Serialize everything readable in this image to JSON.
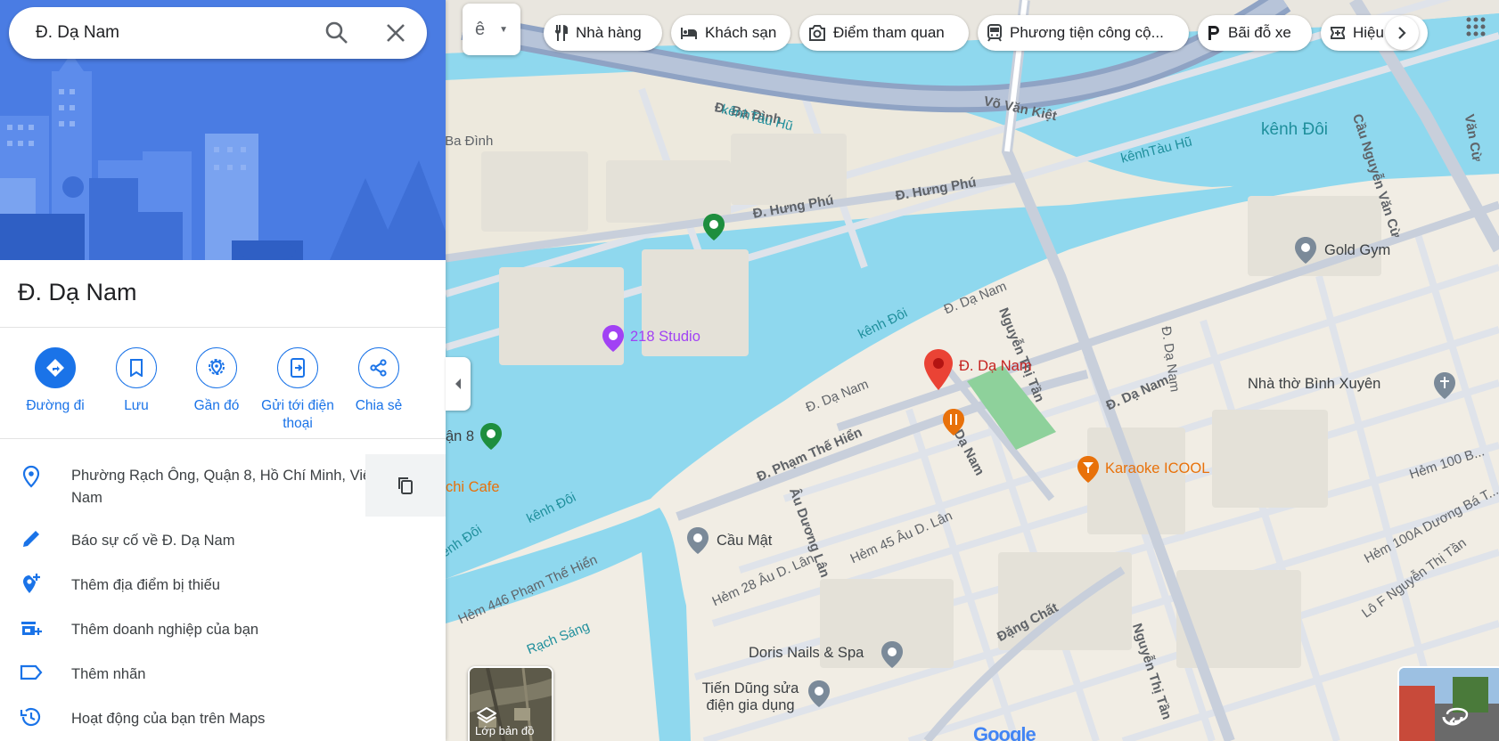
{
  "search": {
    "value": "Đ. Dạ Nam",
    "icon_search": "search-icon",
    "icon_close": "close-icon"
  },
  "place": {
    "title": "Đ. Dạ Nam"
  },
  "actions": [
    {
      "label": "Đường đi",
      "icon": "directions-icon"
    },
    {
      "label": "Lưu",
      "icon": "bookmark-icon"
    },
    {
      "label": "Gần đó",
      "icon": "nearby-icon"
    },
    {
      "label": "Gửi tới điện thoại",
      "icon": "send-to-phone-icon"
    },
    {
      "label": "Chia sẻ",
      "icon": "share-icon"
    }
  ],
  "info": {
    "address": "Phường Rạch Ông, Quận 8, Hồ Chí Minh, Việt Nam",
    "report": "Báo sự cố về Đ. Dạ Nam",
    "add_place": "Thêm địa điểm bị thiếu",
    "add_business": "Thêm doanh nghiệp của bạn",
    "add_label": "Thêm nhãn",
    "activity": "Hoạt động của bạn trên Maps"
  },
  "chips": [
    {
      "label": "Nhà hàng",
      "icon": "restaurant-icon"
    },
    {
      "label": "Khách sạn",
      "icon": "hotel-icon"
    },
    {
      "label": "Điểm tham quan",
      "icon": "camera-icon"
    },
    {
      "label": "Phương tiện công cộ...",
      "icon": "transit-icon"
    },
    {
      "label": "Bãi đỗ xe",
      "icon": "parking-icon"
    },
    {
      "label": "Hiệu",
      "icon": "pharmacy-icon"
    }
  ],
  "map": {
    "layers_label": "Lớp bản đồ",
    "google": "Google",
    "roads": {
      "vo_van_kiet": "Võ Văn Kiệt",
      "ba_dinh_1": "Đ. Ba Đình",
      "ba_dinh_2": "Đ. Ba Đình",
      "hung_phu_1": "Đ. Hưng Phú",
      "hung_phu_2": "Đ. Hưng Phú",
      "nguyen_thi_tan_1": "Nguyễn Thị Tần",
      "nguyen_thi_tan_2": "Nguyễn Thị Tần",
      "da_nam_1": "Đ. Dạ Nam",
      "da_nam_2": "Đ. Dạ Nam",
      "da_nam_3": "Đ. Dạ Nam",
      "da_nam_4": "Đ. Dạ Nam",
      "da_nam_5": "Đ. Dạ Nam",
      "pham_the_hien": "Đ. Phạm Thế Hiển",
      "au_duong_lan": "Âu Dương Lân",
      "hem_446": "Hẻm 446 Phạm Thế Hiển",
      "hem_28": "Hẻm 28 Âu D. Lân",
      "hem_45": "Hẻm 45 Âu D. Lân",
      "dang_chat": "Đặng Chất",
      "hem_100b": "Hẻm 100 B...",
      "hem_100a": "Hẻm 100A Dương Bá T...",
      "lo_f": "Lô F Nguyễn Thị Tần",
      "cau_nguyen_van_cu": "Cầu Nguyễn Văn Cừ",
      "cau": "Cầu",
      "van_cu": "Văn Cừ",
      "rach_sang": "Rạch Sáng"
    },
    "water": {
      "kenh_doi_1": "kênh Đôi",
      "kenh_doi_2": "kênh Đôi",
      "kenh_doi_3": "kênh Đôi",
      "kenh_doi_4": "kênh Đôi",
      "kenh_tau_hu_1": "kênhTàu Hũ",
      "kenh_tau_hu_2": "kênhTàu Hũ"
    },
    "pois": {
      "studio": "218 Studio",
      "pin": "Đ. Dạ Nam",
      "karaoke": "Karaoke ICOOL",
      "gold_gym": "Gold Gym",
      "church": "Nhà thờ Bình Xuyên",
      "cau_mat": "Cầu Mật",
      "doris": "Doris Nails & Spa",
      "tien_dung": "Tiến Dũng sửa điện gia dụng",
      "cafe": "chi Cafe",
      "quan8": "ận 8"
    }
  },
  "colors": {
    "accent": "#1a73e8",
    "water": "#8fd8ee",
    "land": "#f3efe6",
    "pin": "#ea4335",
    "poi_orange": "#e8710a",
    "poi_purple": "#a142f4"
  }
}
